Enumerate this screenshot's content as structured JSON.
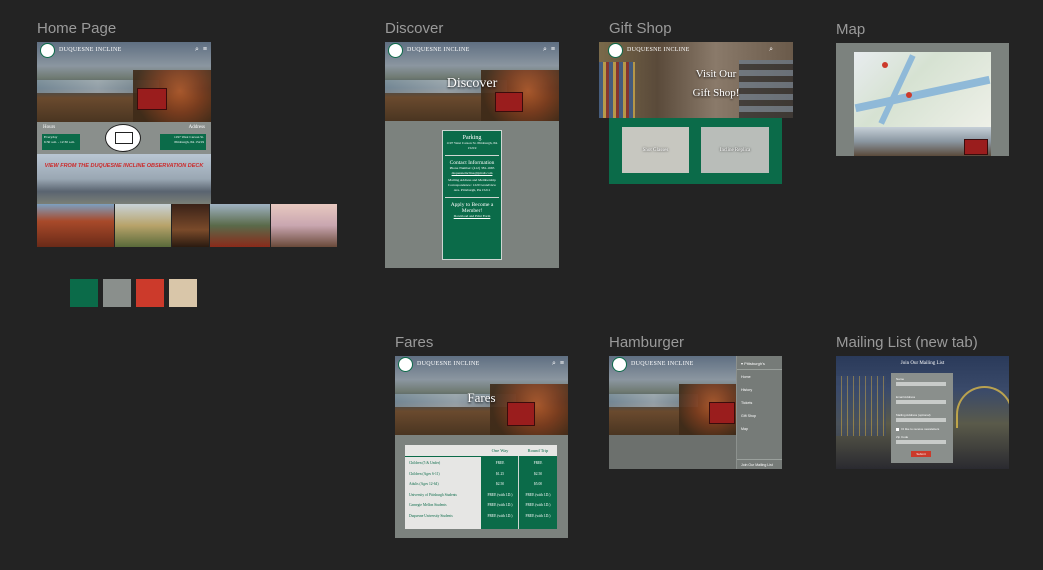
{
  "labels": {
    "home": "Home Page",
    "discover": "Discover",
    "gift": "Gift Shop",
    "map": "Map",
    "fares": "Fares",
    "hamburger": "Hamburger",
    "mailing": "Mailing List (new tab)"
  },
  "brand": "DUQUESNE INCLINE",
  "home": {
    "hours_title": "Hours",
    "hours_days": "Everyday",
    "hours_time": "6:30 a.m. - 12:30 a.m.",
    "address_title": "Address",
    "address_line1": "1197 West Carson St.",
    "address_line2": "Pittsburgh, PA 15219",
    "banner": "VIEW FROM THE DUQUESNE INCLINE OBSERVATION DECK"
  },
  "palette": [
    "#0b6b49",
    "#8a8f8c",
    "#cc3a2b",
    "#d9c6a9"
  ],
  "discover": {
    "hero": "Discover",
    "parking_title": "Parking",
    "parking_text": "1197 West Carson St. Pittsburgh, PA 15219",
    "contact_title": "Contact Information",
    "contact_text": "Phone Number: (412) 381-1665",
    "contact_email": "duquesneincline@gmail.com",
    "mailing_text": "Mailing Address and Membership Correspondence: 1220 Grandview Ave. Pittsburgh, PA 15211",
    "member_title": "Apply to Become a Member!",
    "member_text": "Download and Print Form"
  },
  "gift": {
    "hero_line1": "Visit Our",
    "hero_line2": "Gift Shop!",
    "item1": "Shot Glasses",
    "item2": "Incline Replica"
  },
  "fares": {
    "hero": "Fares",
    "col1": "One Way",
    "col2": "Round Trip",
    "rows": [
      {
        "label": "Children (5 & Under)",
        "one": "FREE",
        "round": "FREE"
      },
      {
        "label": "Children (Ages 6-11)",
        "one": "$1.25",
        "round": "$2.50"
      },
      {
        "label": "Adults (Ages 12-64)",
        "one": "$2.50",
        "round": "$5.00"
      },
      {
        "label": "University of Pittsburgh Students",
        "one": "FREE (with I.D.)",
        "round": "FREE (with I.D.)"
      },
      {
        "label": "Carnegie Mellon Students",
        "one": "FREE (with I.D.)",
        "round": "FREE (with I.D.)"
      },
      {
        "label": "Duquesne University Students",
        "one": "FREE (with I.D.)",
        "round": "FREE (with I.D.)"
      }
    ]
  },
  "menu": {
    "header": "Pittsburgh's",
    "items": [
      "Home",
      "History",
      "Tickets",
      "Gift Shop",
      "Map"
    ],
    "footer": "Join Our Mailing List"
  },
  "mailing": {
    "title": "Join Our Mailing List",
    "f1": "Name",
    "f2": "Email Address",
    "f3": "Mailing Address (optional)",
    "check": "I'd like to receive newsletters",
    "f4": "Zip Code",
    "submit": "Submit"
  }
}
